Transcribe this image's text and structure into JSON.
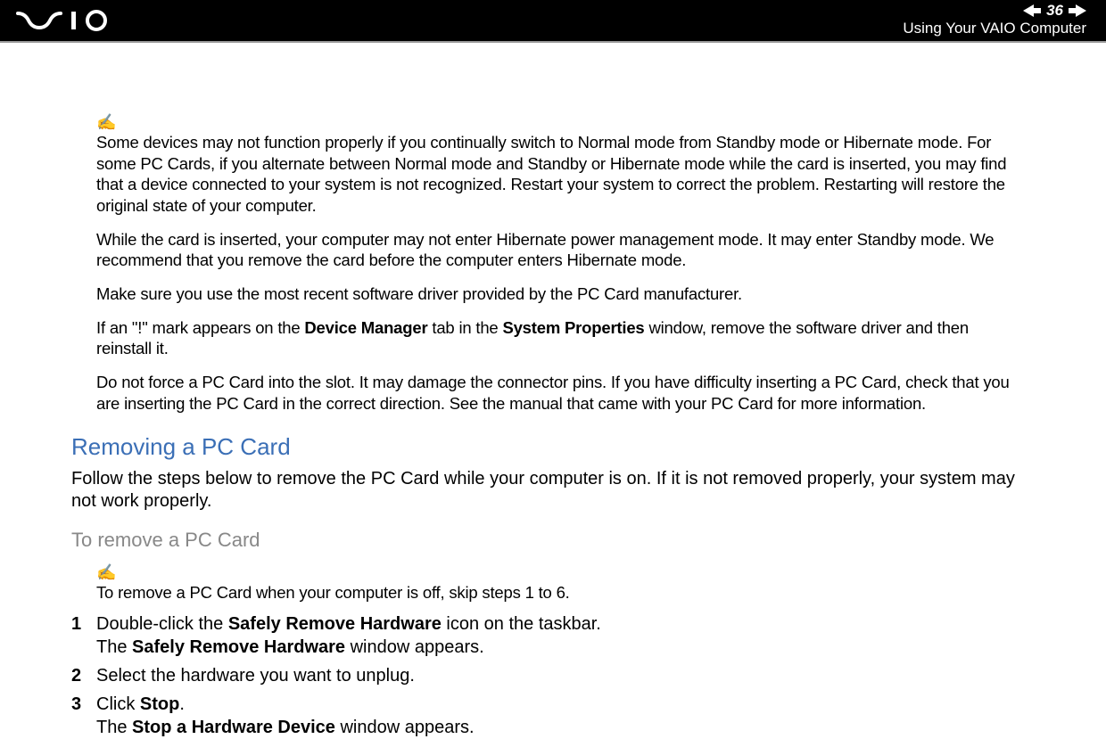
{
  "header": {
    "page_number": "36",
    "chapter": "Using Your VAIO Computer"
  },
  "notes": {
    "p1": "Some devices may not function properly if you continually switch to Normal mode from Standby mode or Hibernate mode. For some PC Cards, if you alternate between Normal mode and Standby or Hibernate mode while the card is inserted, you may find that a device connected to your system is not recognized. Restart your system to correct the problem. Restarting will restore the original state of your computer.",
    "p2": "While the card is inserted, your computer may not enter Hibernate power management mode. It may enter Standby mode. We recommend that you remove the card before the computer enters Hibernate mode.",
    "p3": "Make sure you use the most recent software driver provided by the PC Card manufacturer.",
    "p4_pre": "If an \"!\" mark appears on the ",
    "p4_b1": "Device Manager",
    "p4_mid": " tab in the ",
    "p4_b2": "System Properties",
    "p4_post": " window, remove the software driver and then reinstall it.",
    "p5": "Do not force a PC Card into the slot. It may damage the connector pins. If you have difficulty inserting a PC Card, check that you are inserting the PC Card in the correct direction. See the manual that came with your PC Card for more information."
  },
  "section": {
    "heading": "Removing a PC Card",
    "intro": "Follow the steps below to remove the PC Card while your computer is on. If it is not removed properly, your system may not work properly.",
    "sub_heading": "To remove a PC Card",
    "tip": "To remove a PC Card when your computer is off, skip steps 1 to 6."
  },
  "steps": {
    "s1_num": "1",
    "s1_a": "Double-click the ",
    "s1_b1": "Safely Remove Hardware",
    "s1_c": " icon on the taskbar.",
    "s1_d": "The ",
    "s1_b2": "Safely Remove Hardware",
    "s1_e": " window appears.",
    "s2_num": "2",
    "s2": "Select the hardware you want to unplug.",
    "s3_num": "3",
    "s3_a": "Click ",
    "s3_b1": "Stop",
    "s3_c": ".",
    "s3_d": "The ",
    "s3_b2": "Stop a Hardware Device",
    "s3_e": " window appears."
  }
}
